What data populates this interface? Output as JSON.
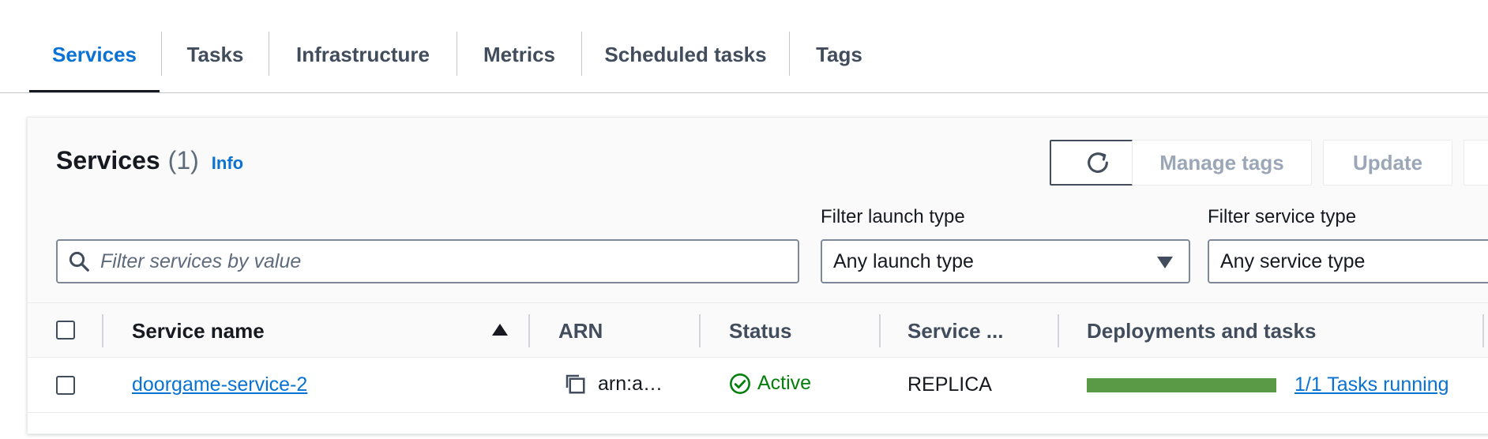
{
  "tabs": [
    {
      "label": "Services",
      "active": true
    },
    {
      "label": "Tasks"
    },
    {
      "label": "Infrastructure"
    },
    {
      "label": "Metrics"
    },
    {
      "label": "Scheduled tasks"
    },
    {
      "label": "Tags"
    }
  ],
  "panel": {
    "title": "Services",
    "count": "(1)",
    "info_link": "Info",
    "buttons": {
      "refresh_icon": "refresh-icon",
      "manage_tags": "Manage tags",
      "update": "Update"
    },
    "search": {
      "placeholder": "Filter services by value",
      "value": ""
    },
    "filters": {
      "launch_type": {
        "label": "Filter launch type",
        "selected": "Any launch type"
      },
      "service_type": {
        "label": "Filter service type",
        "selected": "Any service type"
      }
    }
  },
  "table": {
    "columns": {
      "service_name": "Service name",
      "arn": "ARN",
      "status": "Status",
      "service_type": "Service ...",
      "deployments": "Deployments and tasks"
    },
    "rows": [
      {
        "service_name": "doorgame-service-2",
        "arn": "arn:a…",
        "status": "Active",
        "service_type": "REPLICA",
        "tasks_running_fraction": 1.0,
        "tasks_text": "1/1 Tasks running"
      }
    ]
  },
  "colors": {
    "accent": "#0972d3",
    "status_active": "#037f0c",
    "progress": "#5a9a46"
  }
}
